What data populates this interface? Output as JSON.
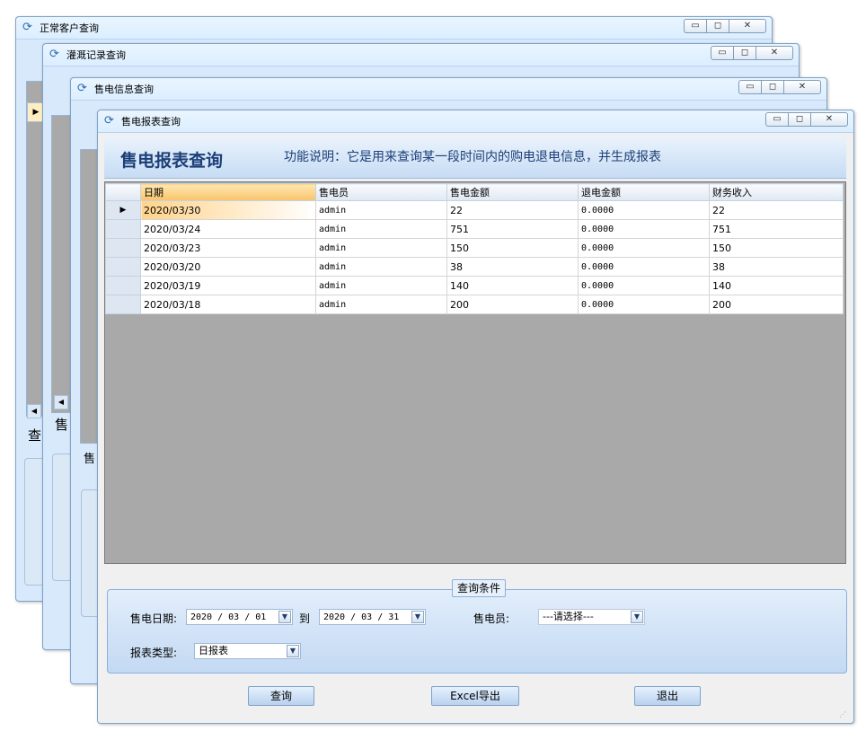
{
  "windows": {
    "customer": {
      "title": "正常客户查询",
      "partial_label": "查"
    },
    "irrigation": {
      "title": "灌溉记录查询",
      "partial_label": "售"
    },
    "salesinfo": {
      "title": "售电信息查询",
      "partial_label": "售"
    },
    "report": {
      "title": "售电报表查询"
    }
  },
  "titlebar_buttons": {
    "minimize": "▭",
    "maximize": "◻",
    "close": "✕"
  },
  "header": {
    "title": "售电报表查询",
    "description": "功能说明：它是用来查询某一段时间内的购电退电信息，并生成报表"
  },
  "table": {
    "columns": [
      "日期",
      "售电员",
      "售电金额",
      "退电金额",
      "财务收入"
    ],
    "rows": [
      [
        "2020/03/30",
        "admin",
        "22",
        "0.0000",
        "22"
      ],
      [
        "2020/03/24",
        "admin",
        "751",
        "0.0000",
        "751"
      ],
      [
        "2020/03/23",
        "admin",
        "150",
        "0.0000",
        "150"
      ],
      [
        "2020/03/20",
        "admin",
        "38",
        "0.0000",
        "38"
      ],
      [
        "2020/03/19",
        "admin",
        "140",
        "0.0000",
        "140"
      ],
      [
        "2020/03/18",
        "admin",
        "200",
        "0.0000",
        "200"
      ]
    ],
    "current_row_marker": "▶"
  },
  "criteria": {
    "group_title": "查询条件",
    "date_label": "售电日期:",
    "date_from": "2020 / 03 / 01",
    "to_label": "到",
    "date_to": "2020 / 03 / 31",
    "seller_label": "售电员:",
    "seller_value": "---请选择---",
    "report_type_label": "报表类型:",
    "report_type_value": "日报表"
  },
  "buttons": {
    "query": "查询",
    "export": "Excel导出",
    "exit": "退出"
  },
  "colors": {
    "header_title": "#1d3f78",
    "window_border": "#7ea3c9",
    "grid_area": "#a9a9a9",
    "selected_header": "#f8c46c"
  }
}
